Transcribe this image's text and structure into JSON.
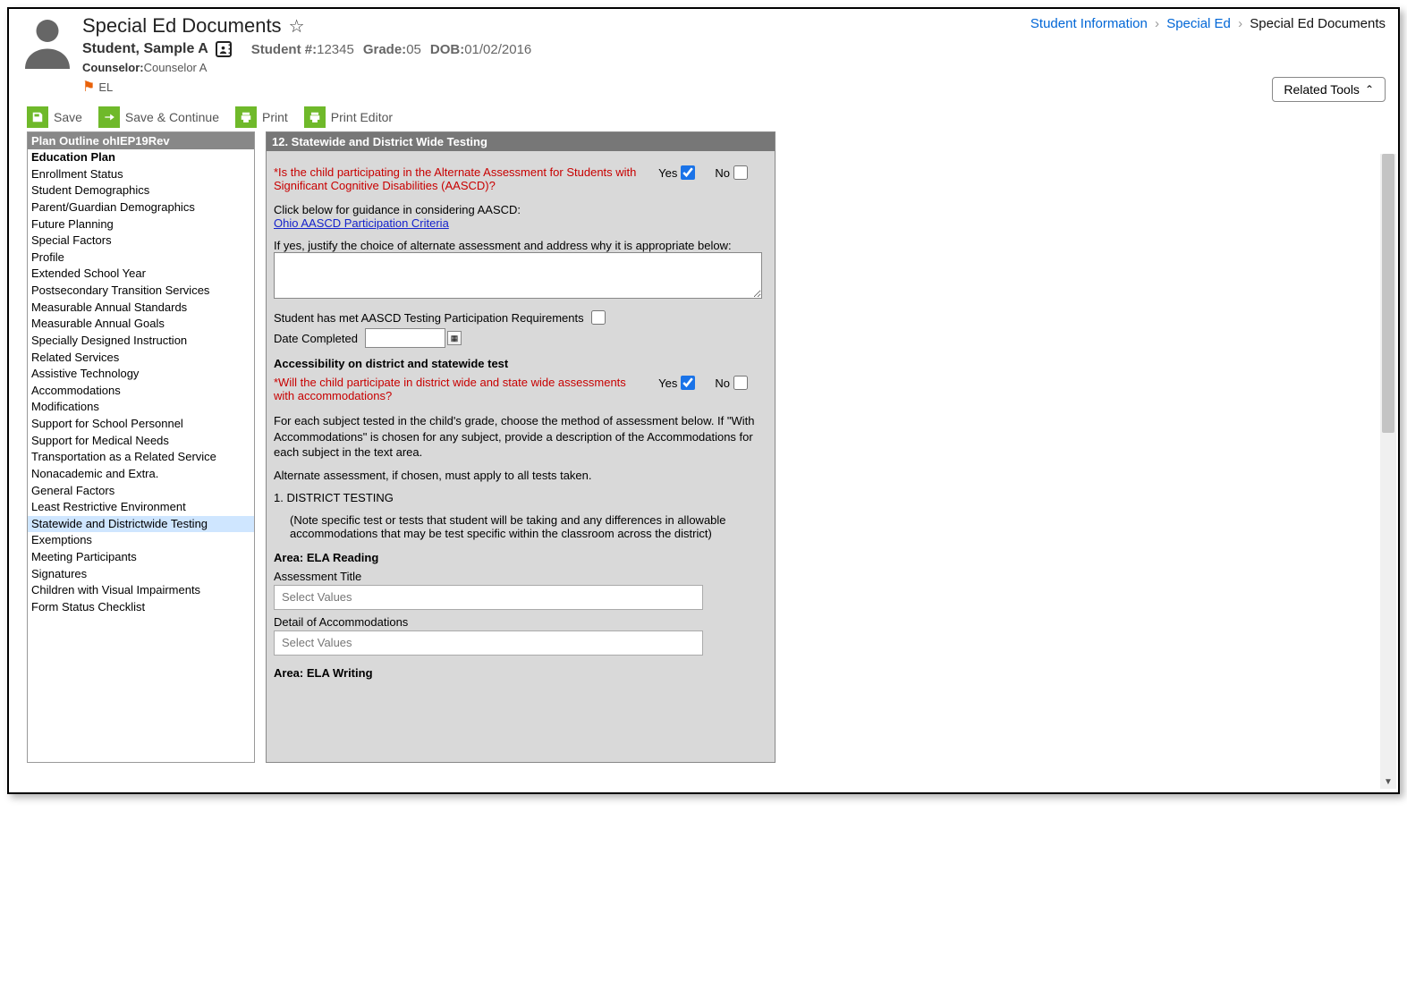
{
  "breadcrumbs": {
    "items": [
      "Student Information",
      "Special Ed",
      "Special Ed Documents"
    ]
  },
  "page": {
    "title": "Special Ed Documents"
  },
  "student": {
    "name": "Student, Sample A",
    "number_label": "Student #:",
    "number": "12345",
    "grade_label": "Grade:",
    "grade": "05",
    "dob_label": "DOB:",
    "dob": "01/02/2016",
    "counselor_label": "Counselor:",
    "counselor": "Counselor A",
    "flag_label": "EL"
  },
  "related_tools_label": "Related Tools",
  "toolbar": {
    "save": "Save",
    "save_continue": "Save & Continue",
    "print": "Print",
    "print_editor": "Print Editor"
  },
  "outline": {
    "header": "Plan Outline ohIEP19Rev",
    "items": [
      {
        "label": "Education Plan",
        "bold": true
      },
      {
        "label": "Enrollment Status"
      },
      {
        "label": "Student Demographics"
      },
      {
        "label": "Parent/Guardian Demographics"
      },
      {
        "label": "Future Planning"
      },
      {
        "label": "Special Factors"
      },
      {
        "label": "Profile"
      },
      {
        "label": "Extended School Year"
      },
      {
        "label": "Postsecondary Transition Services"
      },
      {
        "label": "Measurable Annual Standards"
      },
      {
        "label": "Measurable Annual Goals"
      },
      {
        "label": "Specially Designed Instruction"
      },
      {
        "label": "Related Services"
      },
      {
        "label": "Assistive Technology"
      },
      {
        "label": "Accommodations"
      },
      {
        "label": "Modifications"
      },
      {
        "label": "Support for School Personnel"
      },
      {
        "label": "Support for Medical Needs"
      },
      {
        "label": "Transportation as a Related Service"
      },
      {
        "label": "Nonacademic and Extra."
      },
      {
        "label": "General Factors"
      },
      {
        "label": "Least Restrictive Environment"
      },
      {
        "label": "Statewide and Districtwide Testing",
        "selected": true
      },
      {
        "label": "Exemptions"
      },
      {
        "label": "Meeting Participants"
      },
      {
        "label": "Signatures"
      },
      {
        "label": "Children with Visual Impairments"
      },
      {
        "label": "Form Status Checklist"
      }
    ]
  },
  "form": {
    "section_header": "12. Statewide and District Wide Testing",
    "q1": "*Is the child participating in the Alternate Assessment for Students with Significant Cognitive Disabilities (AASCD)?",
    "yes": "Yes",
    "no": "No",
    "guidance_intro": "Click below for guidance in considering AASCD:",
    "guidance_link": "Ohio AASCD Participation Criteria",
    "justify_label": "If yes, justify the choice of alternate assessment and address why it is appropriate below:",
    "met_reqs_label": "Student has met AASCD Testing Participation Requirements",
    "date_completed_label": "Date Completed",
    "accessibility_header": "Accessibility on district and statewide test",
    "q2": "*Will the child participate in district wide and state wide assessments with accommodations?",
    "para1": "For each subject tested in the child's grade, choose the method of assessment below. If \"With Accommodations\" is chosen for any subject, provide a description of the Accommodations for each subject in the text area.",
    "para2": "Alternate assessment, if chosen, must apply to all tests taken.",
    "district_testing_hdr": "1. DISTRICT TESTING",
    "district_testing_note": "(Note specific test or tests that student will be taking and any differences in allowable accommodations that may be test specific within the classroom across the district)",
    "area1": "Area: ELA Reading",
    "assessment_title_label": "Assessment Title",
    "select_values_placeholder": "Select Values",
    "detail_accom_label": "Detail of Accommodations",
    "area2": "Area: ELA Writing"
  }
}
